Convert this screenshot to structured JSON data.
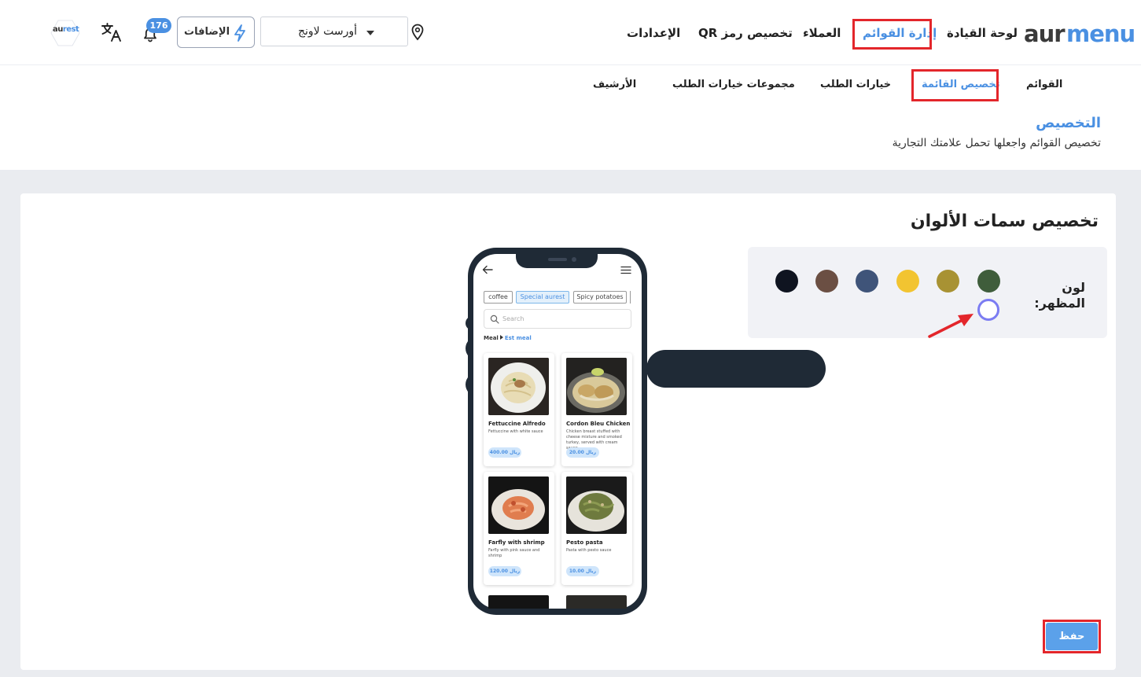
{
  "header": {
    "logo": {
      "part1": "aur",
      "part2": "menu"
    },
    "nav": {
      "dashboard": "لوحة القيادة",
      "menu_management": "إدارة القوائم",
      "customers": "العملاء",
      "qr_customize": "تخصيص رمز QR",
      "settings": "الإعدادات"
    },
    "branch": "أورست لاونج",
    "addons_label": "الإضافات",
    "notifications_count": "176",
    "aurest_logo": {
      "part1": "au",
      "part2": "rest"
    }
  },
  "subnav": {
    "menus": "القوائم",
    "menu_customize": "تخصيص القائمة",
    "order_options": "خيارات الطلب",
    "order_option_groups": "مجموعات خيارات الطلب",
    "archive": "الأرشيف"
  },
  "section": {
    "title": "التخصيص",
    "subtitle": "تخصيص القوائم واجعلها تحمل علامتك التجارية"
  },
  "theme": {
    "title": "تخصيص سمات الألوان",
    "color_label": "لون المظهر:",
    "swatches": [
      "#3f5d3b",
      "#a89233",
      "#f2c431",
      "#3f5479",
      "#6b4f43",
      "#0f1420"
    ],
    "custom_swatch_border": "#7b7cf2",
    "save_label": "حفظ"
  },
  "phone_preview": {
    "chips": [
      "coffee",
      "Special aurest",
      "Spicy potatoes"
    ],
    "search_placeholder": "Search",
    "breadcrumb": {
      "root": "Meal",
      "current": "Est meal"
    },
    "items": [
      {
        "name": "Fettuccine Alfredo",
        "desc": "Fettuccine with white sauce",
        "price": "400.00 ريال"
      },
      {
        "name": "Cordon Bleu Chicken",
        "desc": "Chicken breast stuffed with cheese mixture and smoked turkey, served with cream sauce.",
        "price": "20.00 ريال"
      },
      {
        "name": "Farfly with shrimp",
        "desc": "Farfly with pink sauce and shrimp",
        "price": "120.00 ريال"
      },
      {
        "name": "Pesto pasta",
        "desc": "Pasta with pesto sauce",
        "price": "10.00 ريال"
      }
    ]
  }
}
